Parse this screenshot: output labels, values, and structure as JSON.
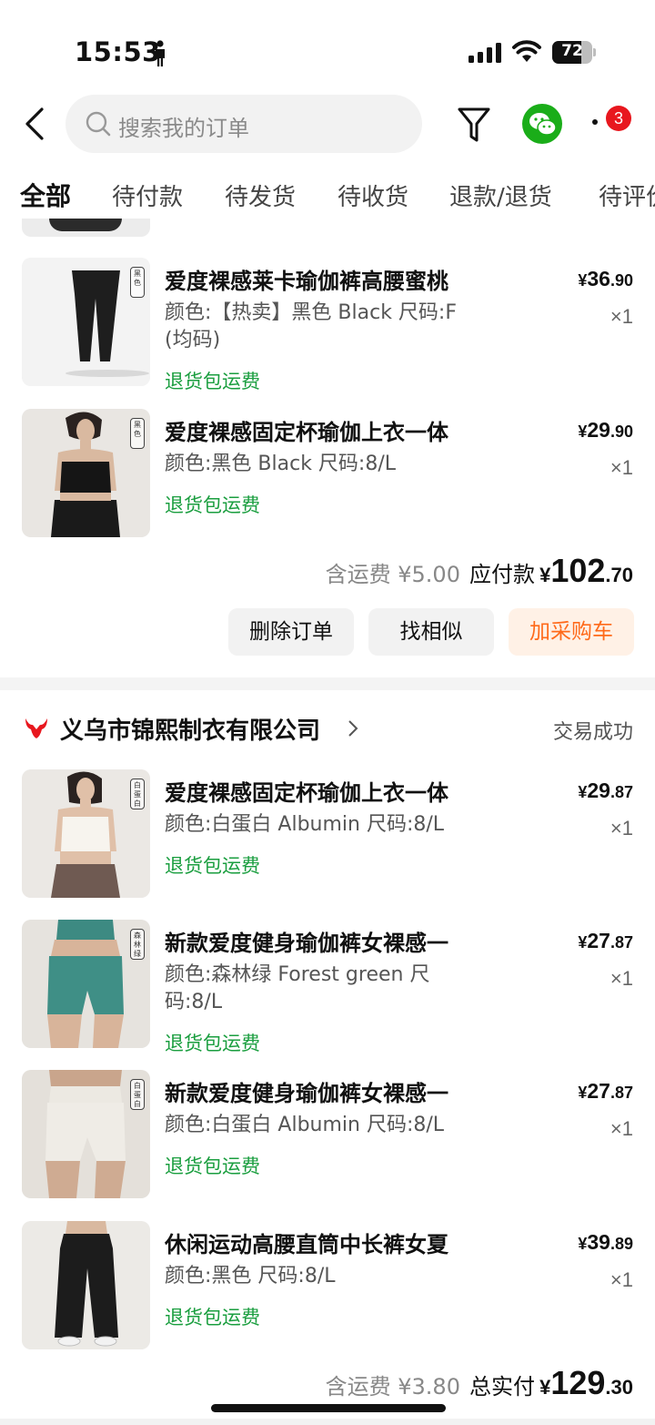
{
  "status_bar": {
    "time": "15:53",
    "battery": "72",
    "battery_level": 0.72
  },
  "header": {
    "search_placeholder": "搜索我的订单",
    "badge_count": "3"
  },
  "tabs": [
    "全部",
    "待付款",
    "待发货",
    "待收货",
    "退款/退货",
    "待评价"
  ],
  "order1": {
    "items": [
      {
        "title": "爱度裸感莱卡瑜伽裤高腰蜜桃",
        "spec": "颜色:【热卖】黑色 Black 尺码:F (均码)",
        "tag": "退货包运费",
        "price_int": "36",
        "price_dec": ".90",
        "qty": "×1",
        "thumb_tag": "黑色"
      },
      {
        "title": "爱度裸感固定杯瑜伽上衣一体",
        "spec": "颜色:黑色 Black 尺码:8/L",
        "tag": "退货包运费",
        "price_int": "29",
        "price_dec": ".90",
        "qty": "×1",
        "thumb_tag": "黑色"
      }
    ],
    "shipping": "含运费 ¥5.00",
    "total_label": "应付款",
    "total_int": "102",
    "total_dec": ".70",
    "buttons": {
      "delete": "删除订单",
      "similar": "找相似",
      "add_cart": "加采购车"
    }
  },
  "order2": {
    "shop_name": "义乌市锦熙制衣有限公司",
    "status": "交易成功",
    "items": [
      {
        "title": "爱度裸感固定杯瑜伽上衣一体",
        "spec": "颜色:白蛋白 Albumin 尺码:8/L",
        "tag": "退货包运费",
        "price_int": "29",
        "price_dec": ".87",
        "qty": "×1",
        "thumb_tag": "白蛋白"
      },
      {
        "title": "新款爱度健身瑜伽裤女裸感一",
        "spec": "颜色:森林绿 Forest green 尺码:8/L",
        "tag": "退货包运费",
        "price_int": "27",
        "price_dec": ".87",
        "qty": "×1",
        "thumb_tag": "森林绿"
      },
      {
        "title": "新款爱度健身瑜伽裤女裸感一",
        "spec": "颜色:白蛋白 Albumin 尺码:8/L",
        "tag": "退货包运费",
        "price_int": "27",
        "price_dec": ".87",
        "qty": "×1",
        "thumb_tag": "白蛋白"
      },
      {
        "title": "休闲运动高腰直筒中长裤女夏",
        "spec": "颜色:黑色 尺码:8/L",
        "tag": "退货包运费",
        "price_int": "39",
        "price_dec": ".89",
        "qty": "×1",
        "thumb_tag": ""
      }
    ],
    "shipping": "含运费 ¥3.80",
    "total_label": "总实付",
    "total_int": "129",
    "total_dec": ".30"
  },
  "currency": "¥",
  "colors": {
    "green_tag": "#1a9e3f",
    "orange": "#ff6a1a",
    "badge_red": "#e8171e",
    "wechat_green": "#1aad19"
  }
}
